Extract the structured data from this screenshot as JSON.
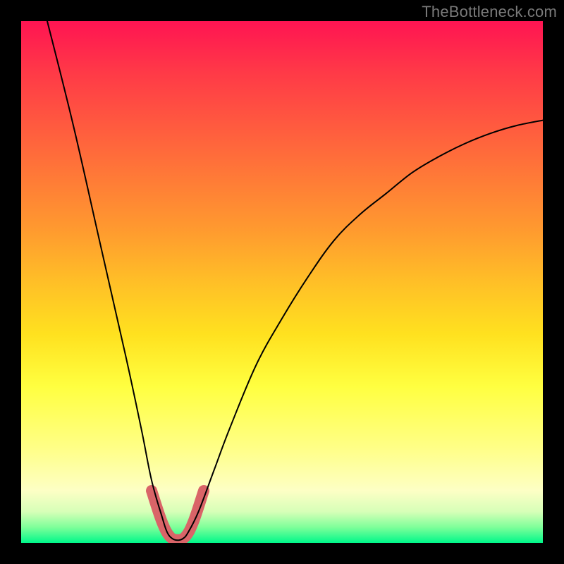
{
  "watermark": "TheBottleneck.com",
  "colors": {
    "accent_red_u": "#d96468",
    "curve_color": "#000000"
  },
  "chart_data": {
    "type": "line",
    "title": "",
    "xlabel": "",
    "ylabel": "",
    "xlim": [
      0,
      100
    ],
    "ylim": [
      0,
      100
    ],
    "grid": false,
    "legend": false,
    "series": [
      {
        "name": "bottleneck-curve",
        "x": [
          5,
          10,
          15,
          20,
          23,
          25,
          27,
          28,
          29,
          30,
          31,
          32,
          34,
          37,
          40,
          45,
          50,
          55,
          60,
          65,
          70,
          75,
          80,
          85,
          90,
          95,
          100
        ],
        "values": [
          100,
          80,
          58,
          36,
          22,
          12,
          5,
          2,
          0.8,
          0.5,
          0.8,
          2,
          6,
          14,
          22,
          34,
          43,
          51,
          58,
          63,
          67,
          71,
          74,
          76.5,
          78.5,
          80,
          81
        ]
      },
      {
        "name": "red-u-segment",
        "x": [
          25,
          27,
          28.5,
          30,
          31.5,
          33,
          35
        ],
        "values": [
          10,
          4,
          1.2,
          0.6,
          1.2,
          4,
          10
        ]
      }
    ]
  }
}
